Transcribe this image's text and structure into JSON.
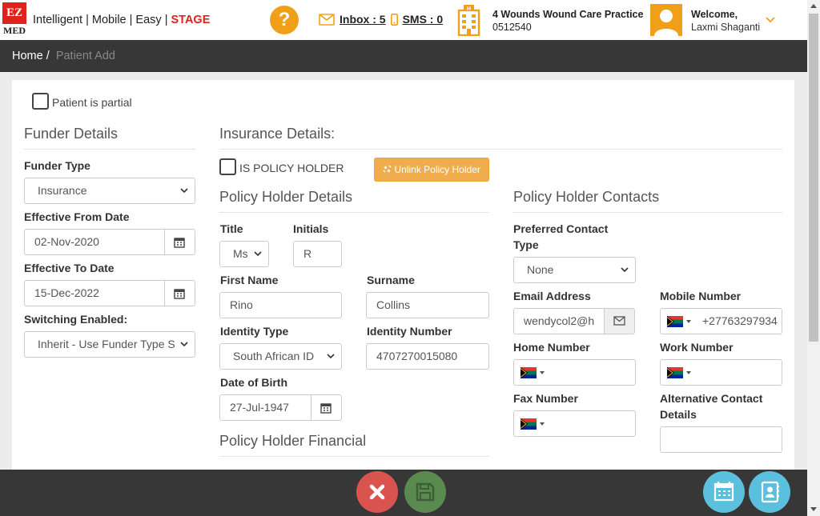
{
  "header": {
    "logo_top": "EZ",
    "logo_bottom": "MED",
    "tagline": "Intelligent | Mobile | Easy | ",
    "stage": "STAGE",
    "help": "?",
    "inbox_label": "Inbox : 5",
    "sms_label": "SMS : 0",
    "practice_name": "4 Wounds Wound Care Practice",
    "practice_number": "0512540",
    "welcome": "Welcome,",
    "user_name": "Laxmi Shaganti"
  },
  "breadcrumb": {
    "home": "Home",
    "separator": "/",
    "current": "Patient Add"
  },
  "form": {
    "patient_partial_label": "Patient is partial",
    "funder": {
      "title": "Funder Details",
      "funder_type_label": "Funder Type",
      "funder_type_value": "Insurance",
      "effective_from_label": "Effective From Date",
      "effective_from_value": "02-Nov-2020",
      "effective_to_label": "Effective To Date",
      "effective_to_value": "15-Dec-2022",
      "switching_label": "Switching Enabled:",
      "switching_value": "Inherit - Use Funder Type S"
    },
    "insurance": {
      "title": "Insurance Details:",
      "is_policy_holder_label": "IS POLICY HOLDER",
      "unlink_button": "Unlink Policy Holder"
    },
    "policy_holder": {
      "title": "Policy Holder Details",
      "title_label": "Title",
      "title_value": "Ms",
      "initials_label": "Initials",
      "initials_value": "R",
      "first_name_label": "First Name",
      "first_name_value": "Rino",
      "surname_label": "Surname",
      "surname_value": "Collins",
      "identity_type_label": "Identity Type",
      "identity_type_value": "South African ID",
      "identity_number_label": "Identity Number",
      "identity_number_value": "4707270015080",
      "dob_label": "Date of Birth",
      "dob_value": "27-Jul-1947",
      "financial_title": "Policy Holder Financial"
    },
    "contacts": {
      "title": "Policy Holder Contacts",
      "preferred_label_1": "Preferred Contact",
      "preferred_label_2": "Type",
      "preferred_value": "None",
      "email_label": "Email Address",
      "email_value": "wendycol2@h",
      "mobile_label": "Mobile Number",
      "mobile_value": "+27763297934",
      "home_label": "Home Number",
      "work_label": "Work Number",
      "fax_label": "Fax Number",
      "alt_label_1": "Alternative Contact",
      "alt_label_2": "Details"
    }
  },
  "colors": {
    "brand_red": "#e0221b",
    "accent_orange": "#f0a018",
    "dark_bar": "#373737",
    "cancel_red": "#d9534f",
    "save_green": "#5a8a4f",
    "action_blue": "#5bc0de"
  },
  "icons": [
    "help-icon",
    "envelope-icon",
    "phone-icon",
    "building-icon",
    "user-avatar-icon",
    "chevron-down-icon",
    "calendar-icon",
    "unlink-icon",
    "flag-za-icon",
    "close-icon",
    "save-icon",
    "calendar-action-icon",
    "contacts-icon"
  ]
}
